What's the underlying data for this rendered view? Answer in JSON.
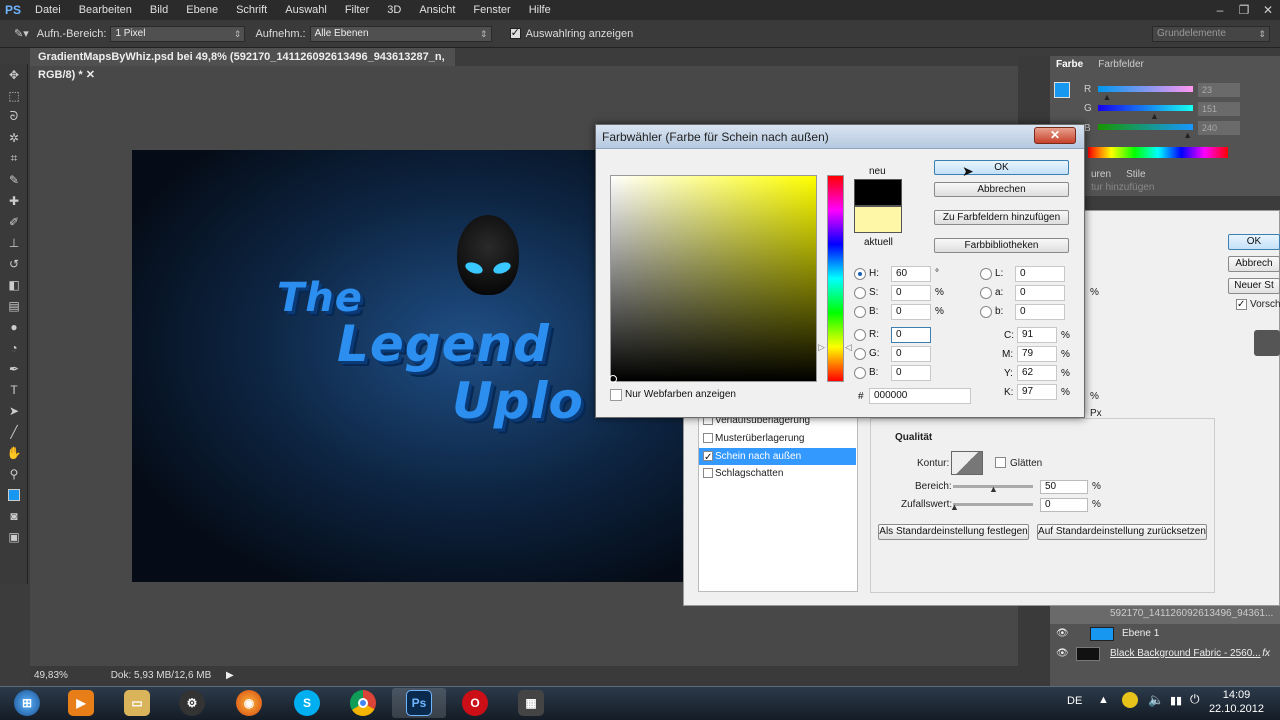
{
  "menubar": {
    "logo": "PS",
    "items": [
      "Datei",
      "Bearbeiten",
      "Bild",
      "Ebene",
      "Schrift",
      "Auswahl",
      "Filter",
      "3D",
      "Ansicht",
      "Fenster",
      "Hilfe"
    ]
  },
  "optbar": {
    "aufn_bereich_label": "Aufn.-Bereich:",
    "aufn_bereich_value": "1 Pixel",
    "aufnehm_label": "Aufnehm.:",
    "aufnehm_value": "Alle Ebenen",
    "ring_label": "Auswahlring anzeigen",
    "workspace": "Grundelemente"
  },
  "document": {
    "tab_title": "GradientMapsByWhiz.psd bei 49,8% (592170_141126092613496_943613287_n, RGB/8) *",
    "zoom": "49,83%",
    "doc_info": "Dok: 5,93 MB/12,6 MB"
  },
  "artwork": {
    "line1": "The",
    "line2": "Legend",
    "line3": "Uplo"
  },
  "color_panel": {
    "tab1": "Farbe",
    "tab2": "Farbfelder",
    "r_label": "R",
    "g_label": "G",
    "b_label": "B",
    "r_value": "23",
    "g_value": "151",
    "b_value": "240",
    "r_fraction": 0.09,
    "g_fraction": 0.59,
    "b_fraction": 0.94
  },
  "styles_tabs": {
    "tab1": "uren",
    "tab2": "Stile",
    "hint": "tur hinzufügen"
  },
  "layers": {
    "row1": "592170_141126092613496_94361...",
    "row2": "Ebene 1",
    "row3": "Black Background Fabric - 2560..."
  },
  "layer_style": {
    "items": [
      {
        "label": "Verlaufsüberlagerung",
        "checked": false
      },
      {
        "label": "Musterüberlagerung",
        "checked": false
      },
      {
        "label": "Schein nach außen",
        "checked": true
      },
      {
        "label": "Schlagschatten",
        "checked": false
      }
    ],
    "quality_title": "Qualität",
    "kontur_label": "Kontur:",
    "glaetten_label": "Glätten",
    "bereich_label": "Bereich:",
    "bereich_value": "50",
    "zufall_label": "Zufallswert:",
    "zufall_value": "0",
    "percent": "%",
    "px": "Px",
    "btn_default_set": "Als Standardeinstellung festlegen",
    "btn_default_reset": "Auf Standardeinstellung zurücksetzen",
    "right_btns": [
      "OK",
      "Abbrech",
      "Neuer St"
    ],
    "vorschau": "Vorsch"
  },
  "picker": {
    "title": "Farbwähler (Farbe für Schein nach außen)",
    "close": "✕",
    "neu": "neu",
    "aktuell": "aktuell",
    "new_color": "#000000",
    "current_color": "#fff7a8",
    "buttons": {
      "ok": "OK",
      "cancel": "Abbrechen",
      "add_swatch": "Zu Farbfeldern hinzufügen",
      "libraries": "Farbbibliotheken"
    },
    "hsb": {
      "H": "60",
      "S": "0",
      "B": "0",
      "deg": "°",
      "pct": "%"
    },
    "rgb": {
      "R": "0",
      "G": "0",
      "B": "0"
    },
    "lab": {
      "L": "0",
      "a": "0",
      "b": "0"
    },
    "cmyk": {
      "C": "91",
      "M": "79",
      "Y": "62",
      "K": "97",
      "pct": "%"
    },
    "hex_label": "#",
    "hex": "000000",
    "webcolors": "Nur Webfarben anzeigen"
  },
  "taskbar": {
    "lang": "DE",
    "time": "14:09",
    "date": "22.10.2012"
  }
}
